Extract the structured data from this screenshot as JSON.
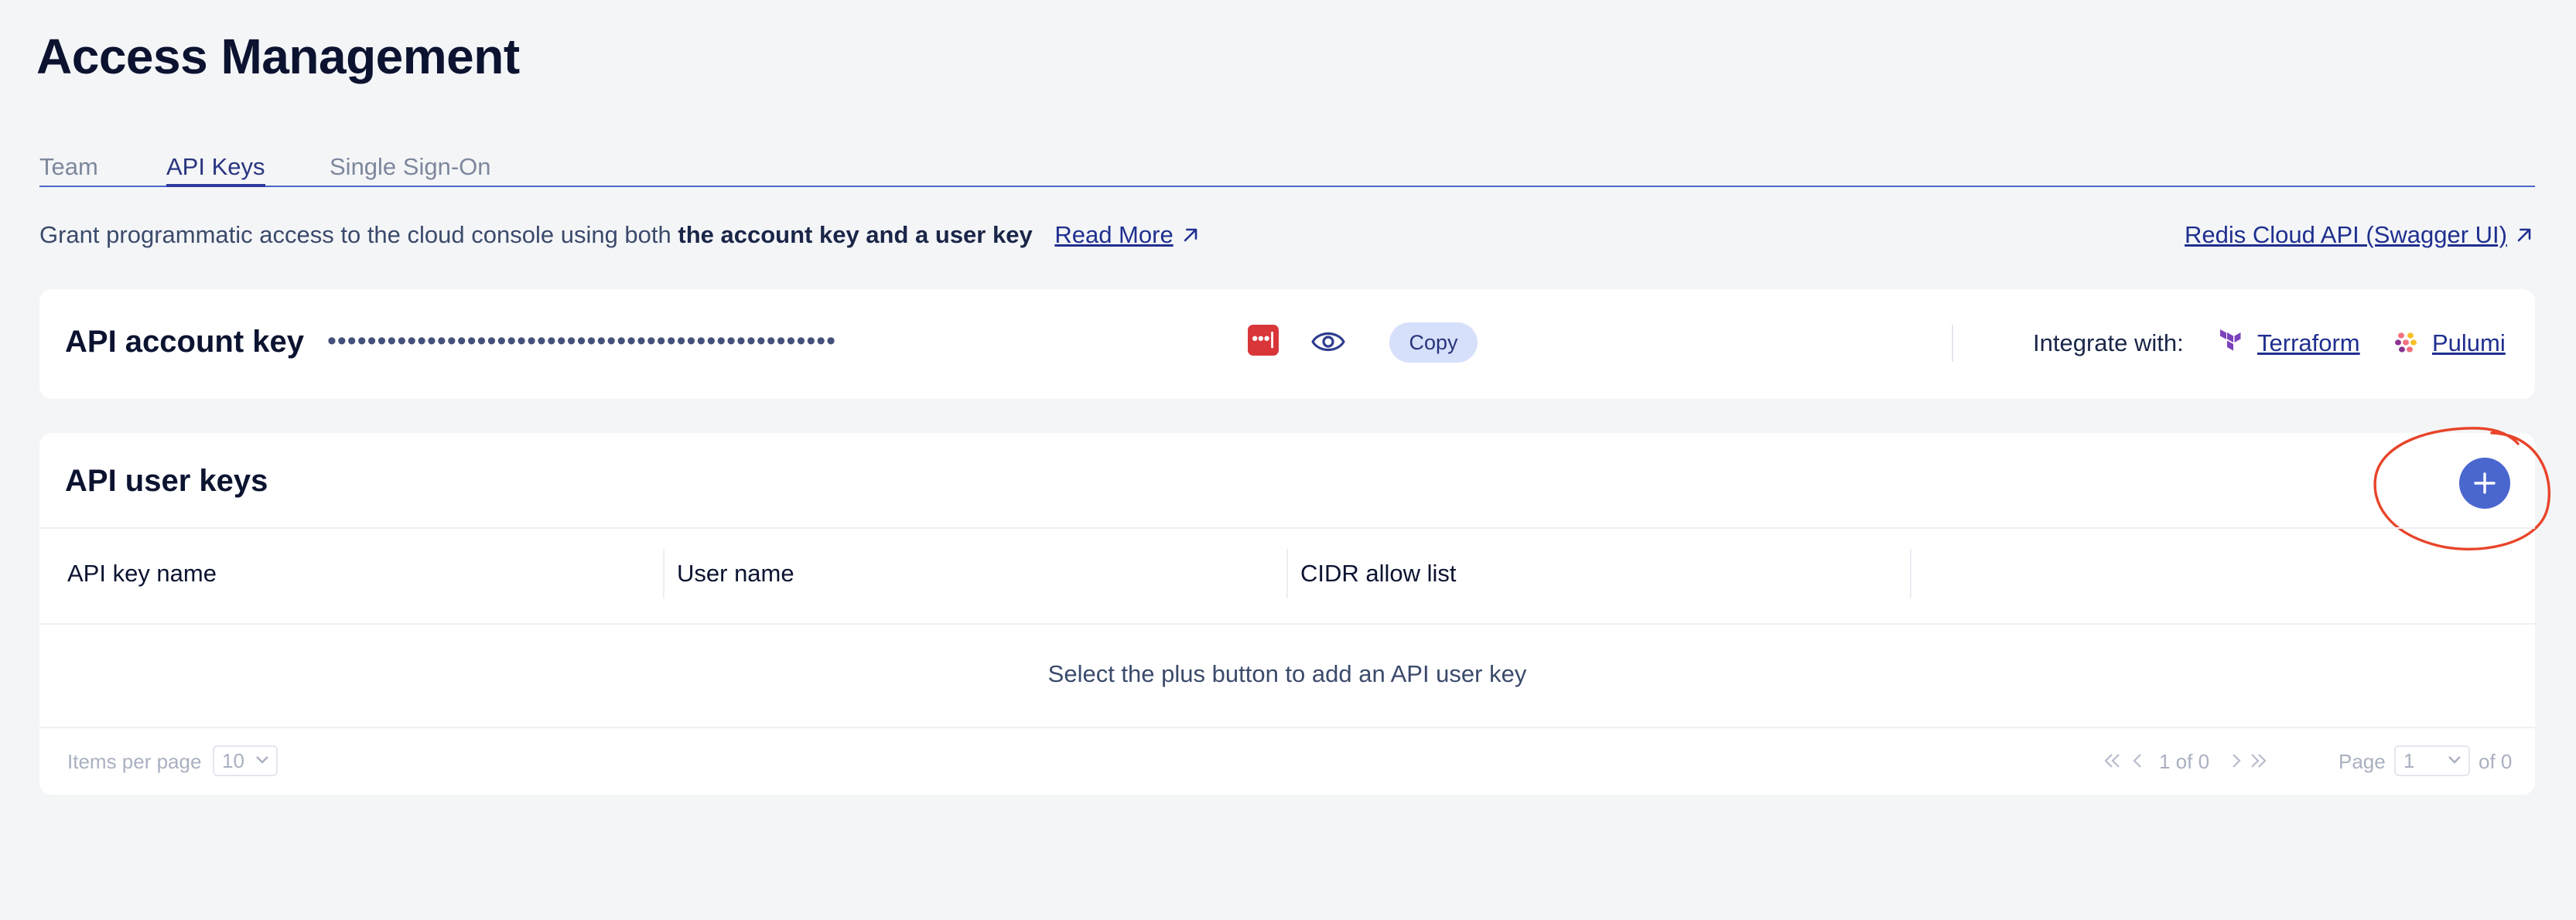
{
  "page": {
    "title": "Access Management"
  },
  "tabs": [
    {
      "label": "Team",
      "active": false
    },
    {
      "label": "API Keys",
      "active": true
    },
    {
      "label": "Single Sign-On",
      "active": false
    }
  ],
  "description": {
    "prefix": "Grant programmatic access to the cloud console using both",
    "bold": "the account key and a user key",
    "read_more": "Read More",
    "swagger_link": "Redis Cloud API (Swagger UI)"
  },
  "account_key": {
    "title": "API account key",
    "masked_value": "•••••••••••••••••••••••••••••••••••••••••••••••••••",
    "copy_label": "Copy",
    "generate_icon_glyph": "•••|",
    "integrate_label": "Integrate with:",
    "integrations": [
      {
        "name": "Terraform",
        "icon": "terraform-icon"
      },
      {
        "name": "Pulumi",
        "icon": "pulumi-icon"
      }
    ]
  },
  "user_keys": {
    "title": "API user keys",
    "columns": [
      "API key name",
      "User name",
      "CIDR allow list"
    ],
    "empty_message": "Select the plus button to add an API user key",
    "pagination": {
      "items_per_page_label": "Items per page",
      "items_per_page_value": "10",
      "range_text": "1 of 0",
      "page_label": "Page",
      "page_value": "1",
      "of_pages": "of 0"
    }
  },
  "colors": {
    "accent": "#4a66cf",
    "highlight_ring": "#e8442a",
    "generate_red": "#d9363a",
    "copy_bg": "#d7e0fb"
  }
}
